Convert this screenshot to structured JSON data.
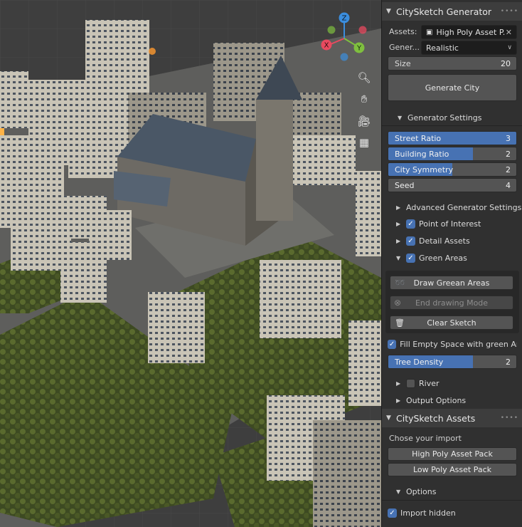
{
  "generator": {
    "title": "CitySketch Generator",
    "assets_label": "Assets:",
    "assets_value": "High Poly Asset P...",
    "generator_label": "Gener...",
    "generator_value": "Realistic",
    "size_label": "Size",
    "size_value": "20",
    "generate_button": "Generate City",
    "settings_label": "Generator Settings",
    "sliders": [
      {
        "name": "Street Ratio",
        "value": "3",
        "fill": 1.0
      },
      {
        "name": "Building Ratio",
        "value": "2",
        "fill": 0.66
      },
      {
        "name": "City Symmetry",
        "value": "2",
        "fill": 0.5
      },
      {
        "name": "Seed",
        "value": "4",
        "fill": 0.0
      }
    ],
    "advanced_label": "Advanced Generator Settings",
    "poi_label": "Point of Interest",
    "detail_label": "Detail Assets",
    "green_label": "Green Areas",
    "draw_green_button": "Draw Greean Areas",
    "end_drawing_button": "End drawing Mode",
    "clear_sketch_button": "Clear Sketch",
    "fill_empty_label": "Fill Empty Space with green Ar...",
    "tree_density": {
      "name": "Tree Density",
      "value": "2",
      "fill": 0.66
    },
    "river_label": "River",
    "output_label": "Output Options"
  },
  "assets": {
    "title": "CitySketch Assets",
    "chose_label": "Chose your import",
    "high_poly_button": "High Poly Asset Pack",
    "low_poly_button": "Low Poly Asset Pack",
    "options_label": "Options",
    "import_hidden_label": "Import hidden"
  },
  "gizmo": {
    "z": "Z",
    "x": "X",
    "y": "Y"
  },
  "colors": {
    "accent": "#4772b3",
    "x_axis": "#e84a5f",
    "y_axis": "#7fbf3f",
    "z_axis": "#3b8ede"
  }
}
